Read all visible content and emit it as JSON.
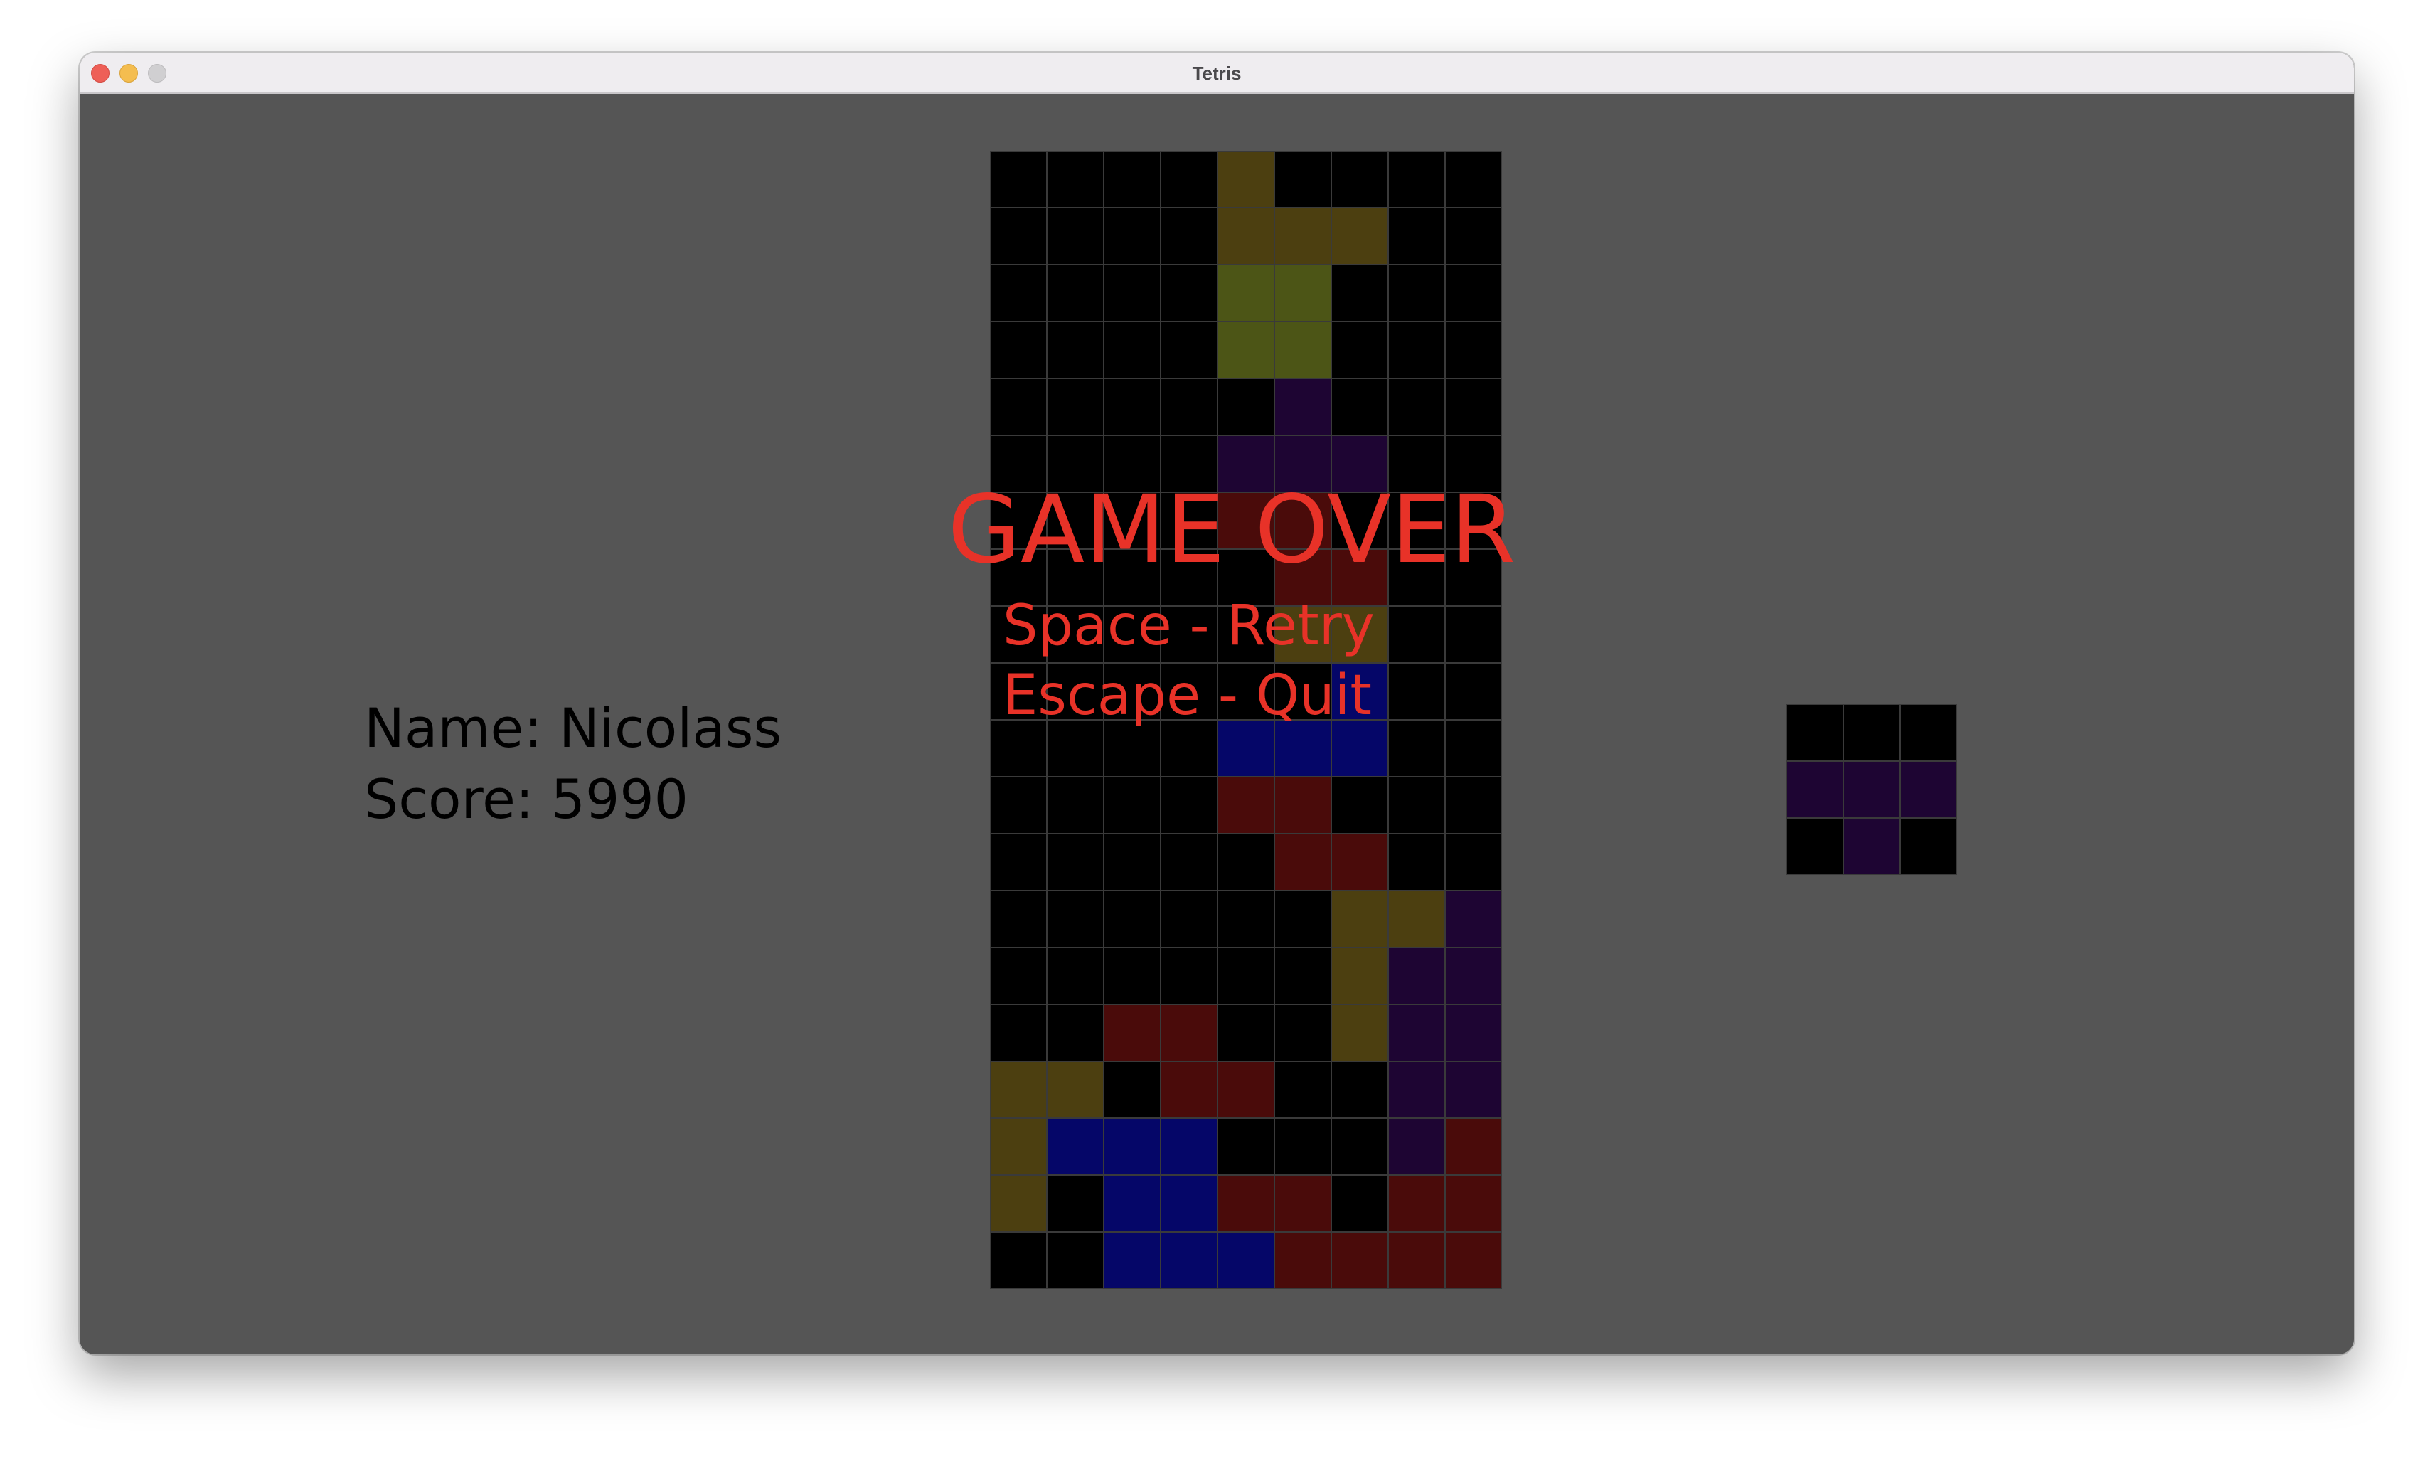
{
  "window": {
    "title": "Tetris"
  },
  "player": {
    "name_line": "Name: Nicolass",
    "score_line": "Score: 5990"
  },
  "overlay": {
    "game_over": "GAME OVER",
    "retry_hint": "Space - Retry",
    "quit_hint": "Escape - Quit"
  },
  "palette": {
    "K": "#000000",
    "O": "#4c3f10",
    "Y": "#4c5516",
    "P": "#1e0533",
    "R": "#4a0b0a",
    "B": "#050668"
  },
  "board": {
    "columns": 9,
    "rows": [
      "KKKKOKKKK",
      "KKKKOOOKK",
      "KKKKYYKKK",
      "KKKKYYKKK",
      "KKKKKPKKK",
      "KKKKPPPKK",
      "KKKKRRKKK",
      "KKKKKRRKK",
      "KKKKKOOKK",
      "KKKKKKBKK",
      "KKKKBBBKK",
      "KKKKRRKKK",
      "KKKKKRRKK",
      "KKKKKKOOP",
      "KKKKKKOPP",
      "KKRRKKOPP",
      "OOKRRKKPP",
      "OBBBKKKPR",
      "OKBBRRKRR",
      "KKBBBRRRR"
    ]
  },
  "next_piece": {
    "rows": [
      "KKK",
      "PPP",
      "KPK"
    ]
  }
}
